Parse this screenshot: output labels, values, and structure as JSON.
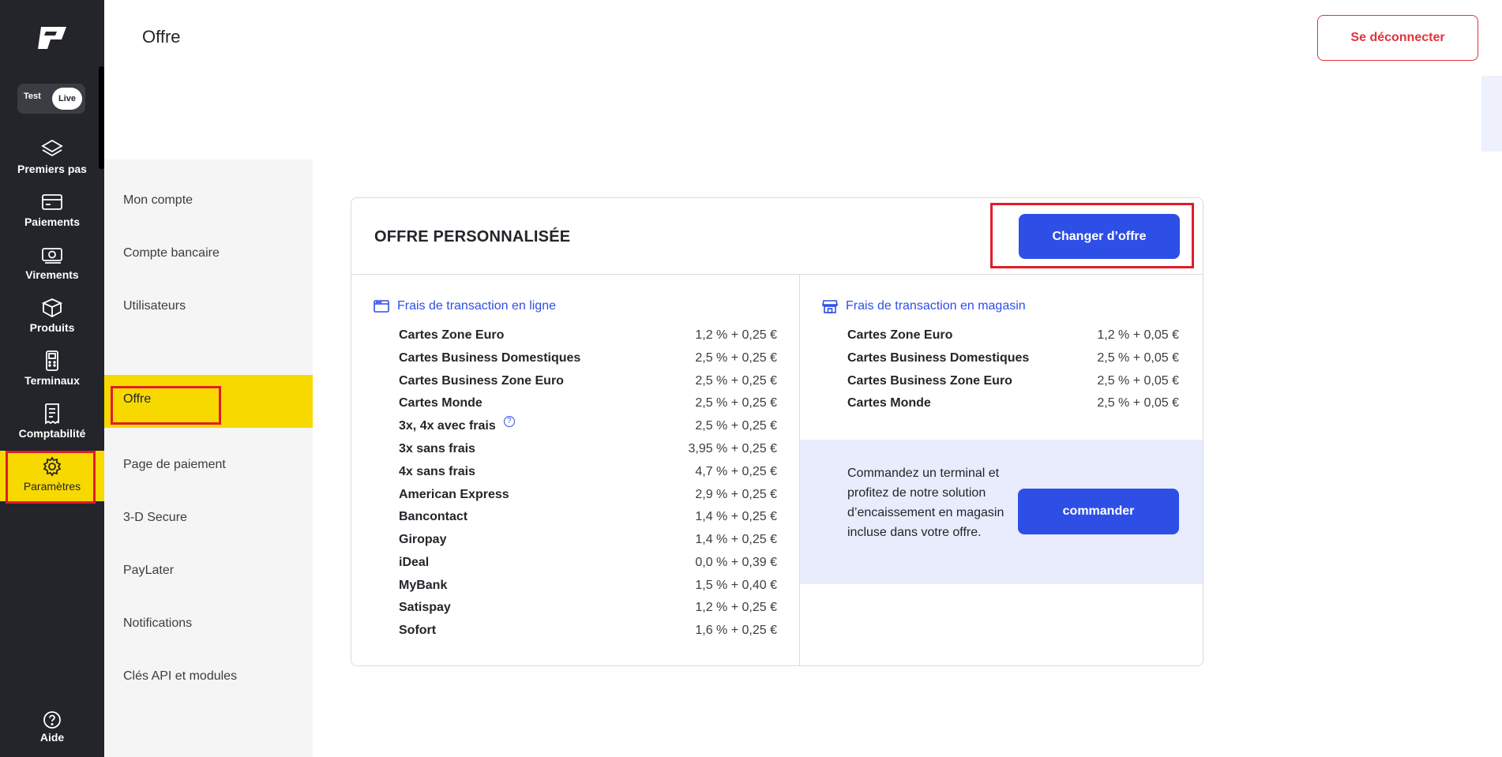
{
  "environment": {
    "test_label": "Test",
    "live_label": "Live",
    "active": "Live"
  },
  "rail": {
    "items": [
      {
        "label": "Premiers pas",
        "icon": "layers-icon"
      },
      {
        "label": "Paiements",
        "icon": "card-icon"
      },
      {
        "label": "Virements",
        "icon": "banknote-icon"
      },
      {
        "label": "Produits",
        "icon": "box-icon"
      },
      {
        "label": "Terminaux",
        "icon": "terminal-icon"
      },
      {
        "label": "Comptabilité",
        "icon": "receipt-icon"
      },
      {
        "label": "Paramètres",
        "icon": "gear-icon",
        "active": true
      }
    ],
    "help_label": "Aide"
  },
  "header": {
    "title": "Offre",
    "logout_label": "Se déconnecter"
  },
  "settings_nav": {
    "items": [
      {
        "label": "Mon compte"
      },
      {
        "label": "Compte bancaire"
      },
      {
        "label": "Utilisateurs"
      },
      {
        "label": "Offre",
        "active": true
      },
      {
        "label": "Page de paiement"
      },
      {
        "label": "3-D Secure"
      },
      {
        "label": "PayLater"
      },
      {
        "label": "Notifications"
      },
      {
        "label": "Clés API et modules"
      }
    ]
  },
  "offer": {
    "title": "OFFRE PERSONNALISÉE",
    "change_label": "Changer d’offre",
    "online": {
      "heading": "Frais de transaction en ligne",
      "rates": [
        {
          "name": "Cartes Zone Euro",
          "value": "1,2 % + 0,25 €"
        },
        {
          "name": "Cartes Business Domestiques",
          "value": "2,5 % + 0,25 €"
        },
        {
          "name": "Cartes Business Zone Euro",
          "value": "2,5 % + 0,25 €"
        },
        {
          "name": "Cartes Monde",
          "value": "2,5 % + 0,25 €"
        },
        {
          "name": "3x, 4x avec frais",
          "value": "2,5 % + 0,25 €",
          "info_icon": "?"
        },
        {
          "name": "3x sans frais",
          "value": "3,95 % + 0,25 €"
        },
        {
          "name": "4x sans frais",
          "value": "4,7 % + 0,25 €"
        },
        {
          "name": "American Express",
          "value": "2,9 % + 0,25 €"
        },
        {
          "name": "Bancontact",
          "value": "1,4 % + 0,25 €"
        },
        {
          "name": "Giropay",
          "value": "1,4 % + 0,25 €"
        },
        {
          "name": "iDeal",
          "value": "0,0 % + 0,39 €"
        },
        {
          "name": "MyBank",
          "value": "1,5 % + 0,40 €"
        },
        {
          "name": "Satispay",
          "value": "1,2 % + 0,25 €"
        },
        {
          "name": "Sofort",
          "value": "1,6 % + 0,25 €"
        }
      ]
    },
    "store": {
      "heading": "Frais de transaction en magasin",
      "rates": [
        {
          "name": "Cartes Zone Euro",
          "value": "1,2 % + 0,05 €"
        },
        {
          "name": "Cartes Business Domestiques",
          "value": "2,5 % + 0,05 €"
        },
        {
          "name": "Cartes Business Zone Euro",
          "value": "2,5 % + 0,05 €"
        },
        {
          "name": "Cartes Monde",
          "value": "2,5 % + 0,05 €"
        }
      ]
    },
    "promo": {
      "text": "Commandez un terminal et profitez de notre solution d’encaissement en magasin incluse dans votre offre.",
      "order_label": "commander"
    }
  },
  "colors": {
    "rail_bg": "#23252a",
    "highlight_yellow": "#f7d900",
    "primary_blue": "#2e4fe6",
    "logout_red": "#e2333f",
    "annotation_red": "#e01c2a"
  }
}
